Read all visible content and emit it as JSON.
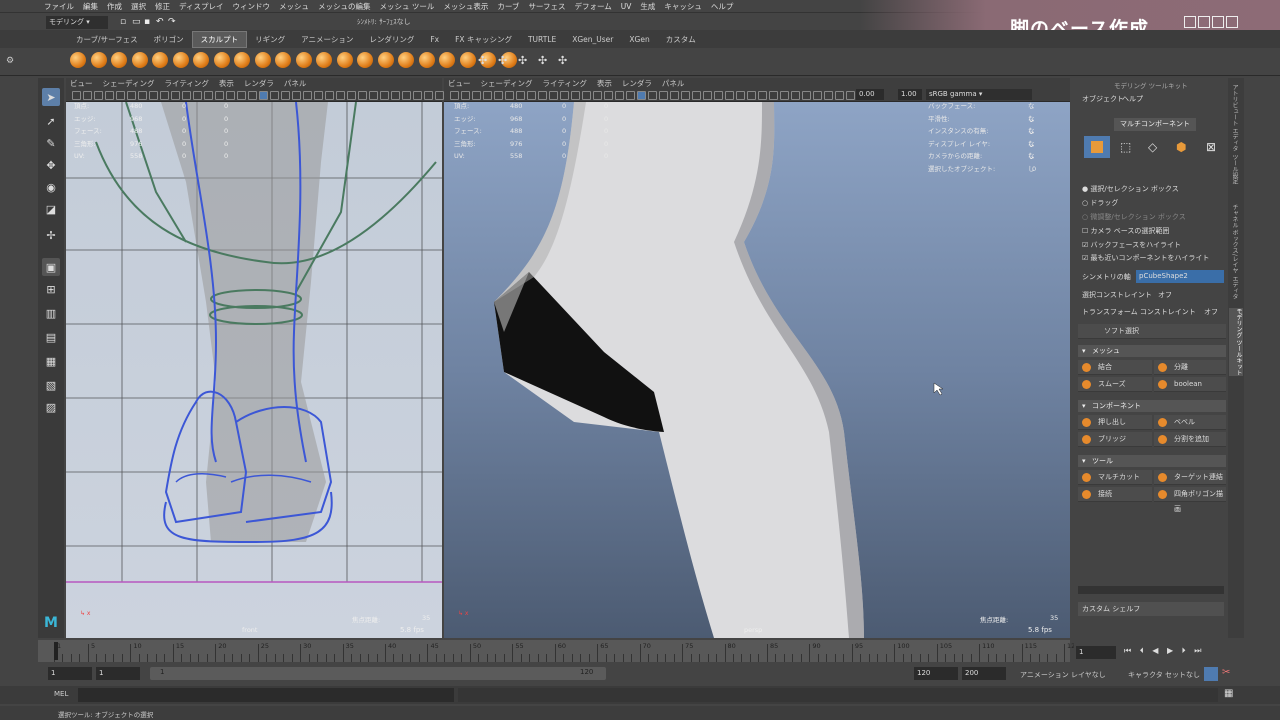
{
  "menubar": [
    "ファイル",
    "編集",
    "作成",
    "選択",
    "修正",
    "ディスプレイ",
    "ウィンドウ",
    "メッシュ",
    "メッシュの編集",
    "メッシュ ツール",
    "メッシュ表示",
    "カーブ",
    "サーフェス",
    "デフォーム",
    "UV",
    "生成",
    "キャッシュ",
    "ヘルプ"
  ],
  "status": {
    "mode": "モデリング",
    "symmetry": "ｼﾝﾒﾄﾘ: ｻｰﾌｪｽなし"
  },
  "video_title": "脚のベース作成",
  "shelf_tabs": [
    "カーブ/サーフェス",
    "ポリゴン",
    "スカルプト",
    "リギング",
    "アニメーション",
    "レンダリング",
    "Fx",
    "FX キャッシング",
    "TURTLE",
    "XGen_User",
    "XGen",
    "カスタム"
  ],
  "active_shelf": "スカルプト",
  "viewport_menu": [
    "ビュー",
    "シェーディング",
    "ライティング",
    "表示",
    "レンダラ",
    "パネル"
  ],
  "persp_toolbar": {
    "exposure": "0.00",
    "gamma": "1.00",
    "colorspace": "sRGB gamma"
  },
  "hud_left": [
    "頂点:",
    "エッジ:",
    "フェース:",
    "三角形:",
    "UV:"
  ],
  "hud_values": [
    "480",
    "968",
    "488",
    "976",
    "558"
  ],
  "hud_zero": "0",
  "hud_right": [
    "バックフェース:",
    "平滑性:",
    "インスタンスの有無:",
    "ディスプレイ レイヤ:",
    "カメラからの距離:",
    "選択したオブジェクト:"
  ],
  "hud_right_val": "なし",
  "front": {
    "label": "front",
    "focal_label": "焦点距離:",
    "focal": "35",
    "fps": "5.8 fps"
  },
  "persp": {
    "label": "persp",
    "focal_label": "焦点距離:",
    "focal": "35",
    "fps": "5.8 fps"
  },
  "panel": {
    "title": "モデリング ツールキット",
    "menu": [
      "オブジェクト",
      "ヘルプ"
    ],
    "multi": "マルチコンポーネント",
    "options": [
      "選択/セレクション ボックス",
      "ドラッグ",
      "微調整/セレクション ボックス"
    ],
    "checks": [
      "カメラ ベースの選択範囲",
      "バックフェースをハイライト",
      "最も近いコンポーネントをハイライト"
    ],
    "symmetry_label": "シンメトリの軸",
    "symmetry_value": "pCubeShape2",
    "select_constraint": "選択コンストレイント",
    "select_constraint_val": "オフ",
    "transform_constraint": "トランスフォーム コンストレイント",
    "transform_constraint_val": "オフ",
    "soft": "ソフト選択",
    "sections": [
      "メッシュ",
      "コンポーネント",
      "ツール"
    ],
    "mesh_btns": [
      "結合",
      "分離",
      "スムーズ",
      "boolean"
    ],
    "comp_btns": [
      "押し出し",
      "ベベル",
      "ブリッジ",
      "分割を追加"
    ],
    "tool_btns": [
      "マルチカット",
      "ターゲット連結",
      "接続",
      "四角ポリゴン描画"
    ],
    "shelf": "カスタム シェルフ"
  },
  "side_tabs": [
    "アトリビュート エディタ",
    "ツール設定",
    "チャネル ボックス/レイヤ エディタ",
    "モデリング ツールキット"
  ],
  "timeline_ticks": [
    "1",
    "5",
    "10",
    "15",
    "20",
    "25",
    "30",
    "35",
    "40",
    "45",
    "50",
    "55",
    "60",
    "65",
    "70",
    "75",
    "80",
    "85",
    "90",
    "95",
    "100",
    "105",
    "110",
    "115",
    "120"
  ],
  "current_frame": "1",
  "range": {
    "start": "1",
    "start2": "1",
    "slider_start": "1",
    "slider_end": "120",
    "end": "120",
    "end2": "200",
    "anim_layer": "アニメーション レイヤなし",
    "char_set": "キャラクタ セットなし"
  },
  "cmd_label": "MEL",
  "help": "選択ツール: オブジェクトの選択"
}
